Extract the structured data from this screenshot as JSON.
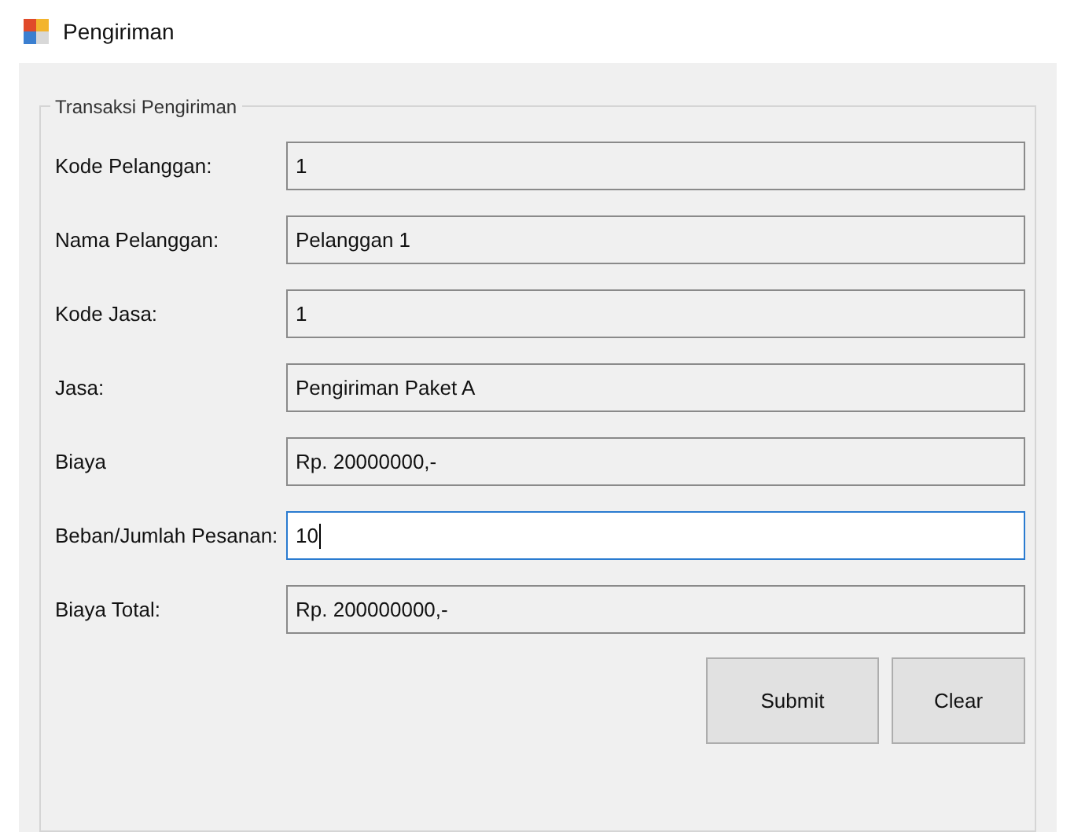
{
  "window": {
    "title": "Pengiriman"
  },
  "group": {
    "title": "Transaksi Pengiriman",
    "fields": [
      {
        "label": "Kode Pelanggan:",
        "value": "1",
        "read_only": true,
        "focused": false
      },
      {
        "label": "Nama Pelanggan:",
        "value": "Pelanggan 1",
        "read_only": true,
        "focused": false
      },
      {
        "label": "Kode Jasa:",
        "value": "1",
        "read_only": true,
        "focused": false
      },
      {
        "label": "Jasa:",
        "value": "Pengiriman Paket A",
        "read_only": true,
        "focused": false
      },
      {
        "label": "Biaya",
        "value": "Rp. 20000000,-",
        "read_only": true,
        "focused": false
      },
      {
        "label": "Beban/Jumlah Pesanan:",
        "value": "10",
        "read_only": false,
        "focused": true
      },
      {
        "label": "Biaya Total:",
        "value": "Rp. 200000000,-",
        "read_only": true,
        "focused": false
      }
    ],
    "buttons": [
      "Submit",
      "Clear"
    ]
  }
}
